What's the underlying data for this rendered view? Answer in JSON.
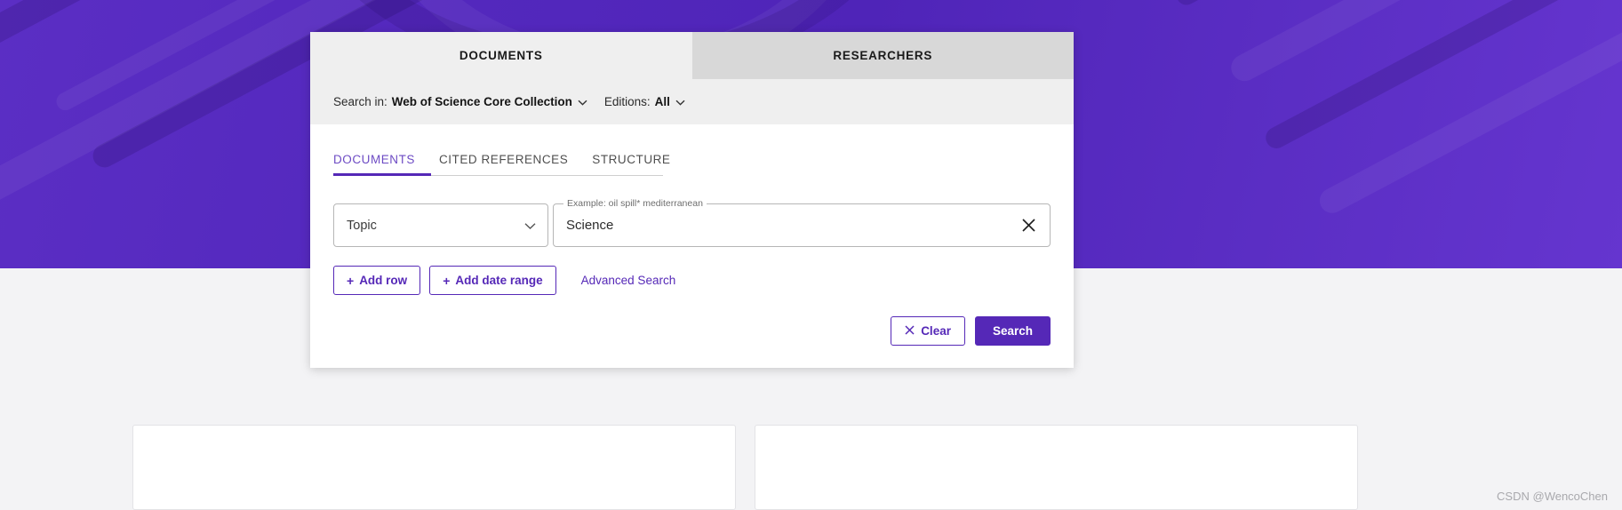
{
  "theme": {
    "brand_purple": "#5528B7",
    "tab_active_bg": "#EFEFEF",
    "tab_inactive_bg": "#D8D8D8",
    "link_purple": "#5528B7",
    "hero_purple": "#5B2EC4"
  },
  "outer_tabs": [
    {
      "label": "DOCUMENTS",
      "active": true
    },
    {
      "label": "RESEARCHERS",
      "active": false
    }
  ],
  "search_in": {
    "label": "Search in:",
    "collection_value": "Web of Science Core Collection",
    "editions_label": "Editions:",
    "editions_value": "All",
    "caret": "chevron-down-icon"
  },
  "inner_tabs": [
    {
      "label": "DOCUMENTS",
      "active": true
    },
    {
      "label": "CITED REFERENCES",
      "active": false
    },
    {
      "label": "STRUCTURE",
      "active": false
    }
  ],
  "query_row": {
    "field_select_value": "Topic",
    "field_select_caret": "chevron-down-icon",
    "search_legend": "Example: oil spill* mediterranean",
    "search_value": "Science",
    "clear_icon": "close-icon"
  },
  "actions": {
    "add_row_label": "Add row",
    "add_date_range_label": "Add date range",
    "plus_glyph": "+",
    "advanced_search_label": "Advanced Search"
  },
  "footer": {
    "clear_label": "Clear",
    "clear_icon": "close-icon",
    "search_label": "Search"
  },
  "watermark": "CSDN @WencoChen"
}
